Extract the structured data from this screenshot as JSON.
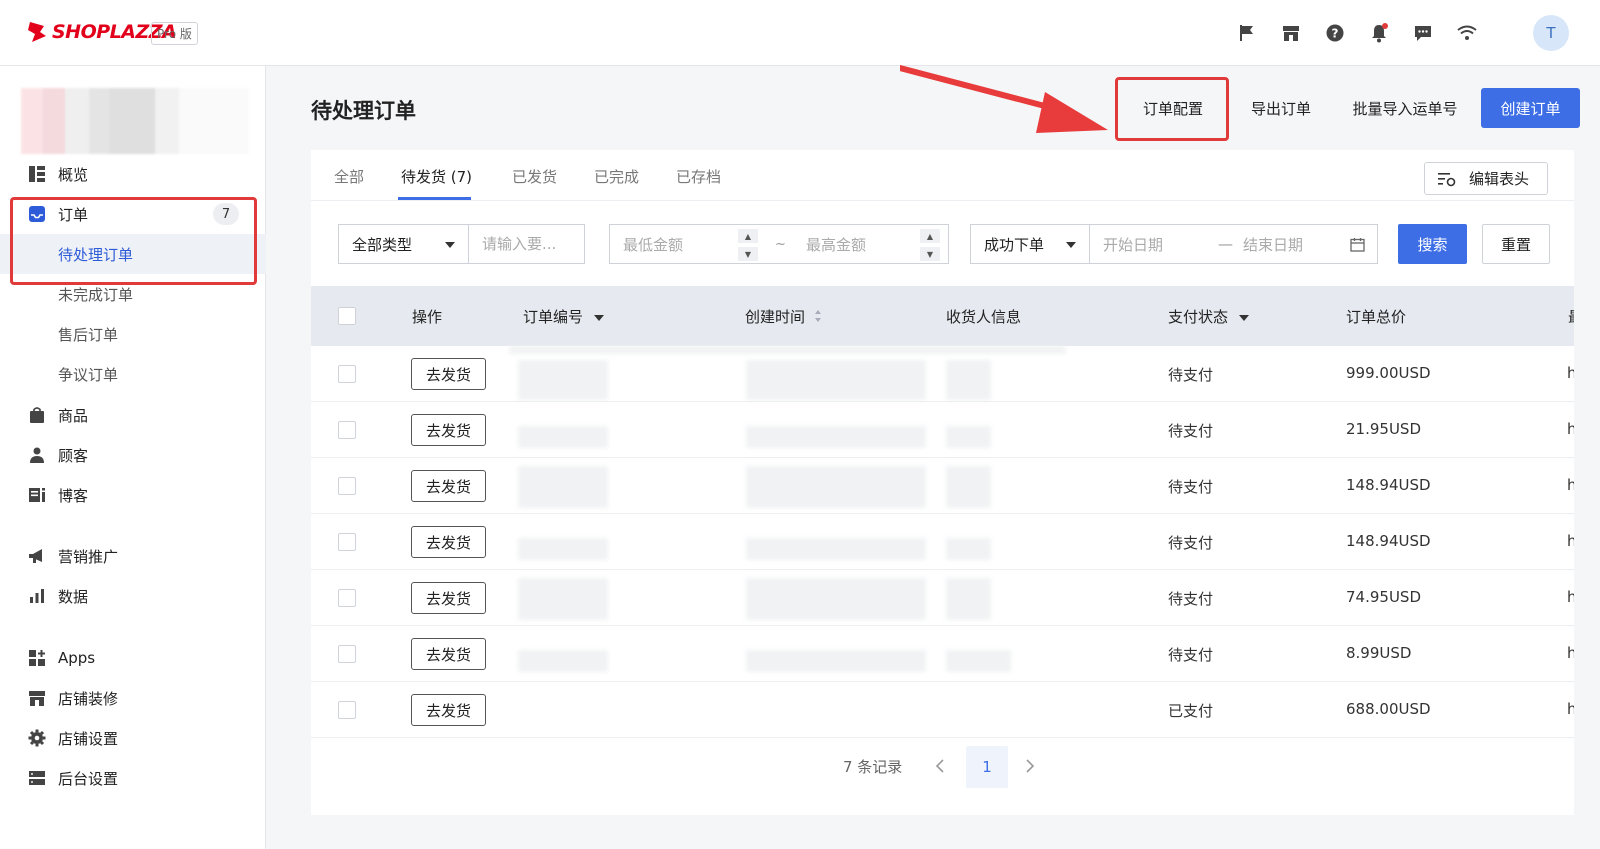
{
  "header": {
    "brand": "SHOPLAZZA",
    "plan_badge": "Pro 版",
    "avatar_initial": "T",
    "icons": [
      "flag-icon",
      "store-icon",
      "help-icon",
      "bell-icon",
      "message-icon",
      "wifi-icon"
    ]
  },
  "sidebar": {
    "items": [
      {
        "label": "概览",
        "icon": "dashboard-icon"
      },
      {
        "label": "订单",
        "icon": "inbox-icon",
        "badge": "7"
      },
      {
        "label": "商品",
        "icon": "bag-icon"
      },
      {
        "label": "顾客",
        "icon": "person-icon"
      },
      {
        "label": "博客",
        "icon": "blog-icon"
      },
      {
        "label": "营销推广",
        "icon": "megaphone-icon"
      },
      {
        "label": "数据",
        "icon": "bar-chart-icon"
      },
      {
        "label": "Apps",
        "icon": "apps-icon"
      },
      {
        "label": "店铺装修",
        "icon": "storefront-icon"
      },
      {
        "label": "店铺设置",
        "icon": "gear-icon"
      },
      {
        "label": "后台设置",
        "icon": "server-icon"
      }
    ],
    "order_sub": [
      "待处理订单",
      "未完成订单",
      "售后订单",
      "争议订单"
    ]
  },
  "main": {
    "title": "待处理订单",
    "actions": {
      "config": "订单配置",
      "export": "导出订单",
      "import": "批量导入运单号",
      "create": "创建订单"
    },
    "tabs": [
      "全部",
      "待发货 (7)",
      "已发货",
      "已完成",
      "已存档"
    ],
    "edit_header": "编辑表头",
    "filters": {
      "type": "全部类型",
      "keyword_placeholder": "请输入要...",
      "min_amount": "最低金额",
      "range_sep": "~",
      "max_amount": "最高金额",
      "status": "成功下单",
      "start_date": "开始日期",
      "date_sep": "—",
      "end_date": "结束日期",
      "search": "搜索",
      "reset": "重置"
    },
    "table": {
      "columns": [
        "操作",
        "订单编号",
        "创建时间",
        "收货人信息",
        "支付状态",
        "订单总价",
        "最"
      ],
      "action_label": "去发货",
      "rows": [
        {
          "status": "待支付",
          "total": "999.00USD",
          "extra": "ht"
        },
        {
          "status": "待支付",
          "total": "21.95USD",
          "extra": "ht"
        },
        {
          "status": "待支付",
          "total": "148.94USD",
          "extra": "ht"
        },
        {
          "status": "待支付",
          "total": "148.94USD",
          "extra": "ht"
        },
        {
          "status": "待支付",
          "total": "74.95USD",
          "extra": "ht"
        },
        {
          "status": "待支付",
          "total": "8.99USD",
          "extra": "ht"
        },
        {
          "status": "已支付",
          "total": "688.00USD",
          "extra": "ht"
        }
      ]
    },
    "pagination": {
      "records": "7 条记录",
      "current": "1"
    }
  },
  "colors": {
    "accent": "#3d6ee6",
    "brand": "#e2001a",
    "highlight": "#e03a3a"
  }
}
